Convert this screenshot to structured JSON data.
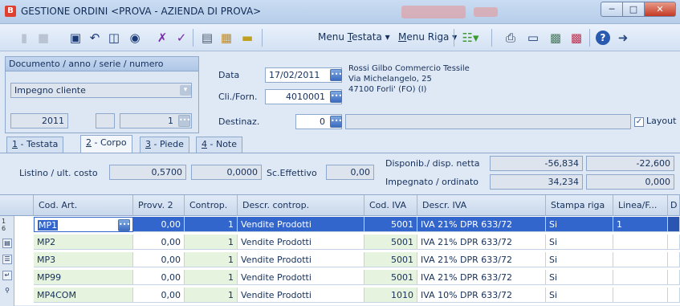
{
  "window": {
    "title": "GESTIONE ORDINI <PROVA - AZIENDA DI PROVA>",
    "app_icon": "B",
    "minimize_icon": "minimize-icon",
    "maximize_icon": "maximize-icon",
    "close_icon": "close-icon"
  },
  "toolbar": {
    "menu_testata": "Menu Testata",
    "menu_riga": "Menu Riga",
    "menu_testata_key": "T",
    "menu_riga_key": "M"
  },
  "documento": {
    "label": "Documento / anno / serie / numero",
    "tipo": "Impegno cliente",
    "anno": "2011",
    "serie": "",
    "numero": "1"
  },
  "header": {
    "data_label": "Data",
    "data_value": "17/02/2011",
    "cliforn_label": "Cli./Forn.",
    "cliforn_value": "4010001",
    "destinaz_label": "Destinaz.",
    "destinaz_value": "0",
    "address_line1": "Rossi Gilbo  Commercio Tessile",
    "address_line2": "Via Michelangelo, 25",
    "address_line3": "47100 Forli'  (FO)  (I)",
    "layout_label": "Layout",
    "layout_checked": true
  },
  "tabs": [
    {
      "key": "1",
      "label": " - Testata"
    },
    {
      "key": "2",
      "label": " - Corpo"
    },
    {
      "key": "3",
      "label": " - Piede"
    },
    {
      "key": "4",
      "label": " - Note"
    }
  ],
  "detail": {
    "listino_label": "Listino / ult. costo",
    "listino_value": "0,5700",
    "ultcosto_value": "0,0000",
    "sceff_label": "Sc.Effettivo",
    "sceff_value": "0,00",
    "disponib_label": "Disponib./ disp. netta",
    "disponib_value": "-56,834",
    "disp_netta_value": "-22,600",
    "impegnato_label": "Impegnato / ordinato",
    "impegnato_value": "34,234",
    "ordinato_value": "0,000"
  },
  "grid": {
    "columns": [
      "Cod. Art.",
      "Provv. 2",
      "Controp.",
      "Descr. controp.",
      "Cod. IVA",
      "Descr. IVA",
      "Stampa riga",
      "Linea/F...",
      "D"
    ],
    "rows": [
      {
        "codart": "MP1",
        "provv": "0,00",
        "controp": "1",
        "descr_controp": "Vendite Prodotti",
        "codiva": "5001",
        "descr_iva": "IVA 21% DPR 633/72",
        "stampa": "Si",
        "linea": "1",
        "d": ""
      },
      {
        "codart": "MP2",
        "provv": "0,00",
        "controp": "1",
        "descr_controp": "Vendite Prodotti",
        "codiva": "5001",
        "descr_iva": "IVA 21% DPR 633/72",
        "stampa": "Si",
        "linea": "",
        "d": ""
      },
      {
        "codart": "MP3",
        "provv": "0,00",
        "controp": "1",
        "descr_controp": "Vendite Prodotti",
        "codiva": "5001",
        "descr_iva": "IVA 21% DPR 633/72",
        "stampa": "Si",
        "linea": "",
        "d": ""
      },
      {
        "codart": "MP99",
        "provv": "0,00",
        "controp": "1",
        "descr_controp": "Vendite Prodotti",
        "codiva": "5001",
        "descr_iva": "IVA 21% DPR 633/72",
        "stampa": "Si",
        "linea": "",
        "d": ""
      },
      {
        "codart": "MP4COM",
        "provv": "0,00",
        "controp": "1",
        "descr_controp": "Vendite Prodotti",
        "codiva": "1010",
        "descr_iva": "IVA 10% DPR 633/72",
        "stampa": "Si",
        "linea": "",
        "d": ""
      }
    ],
    "gutter_top": "1",
    "gutter_sub": "6"
  }
}
